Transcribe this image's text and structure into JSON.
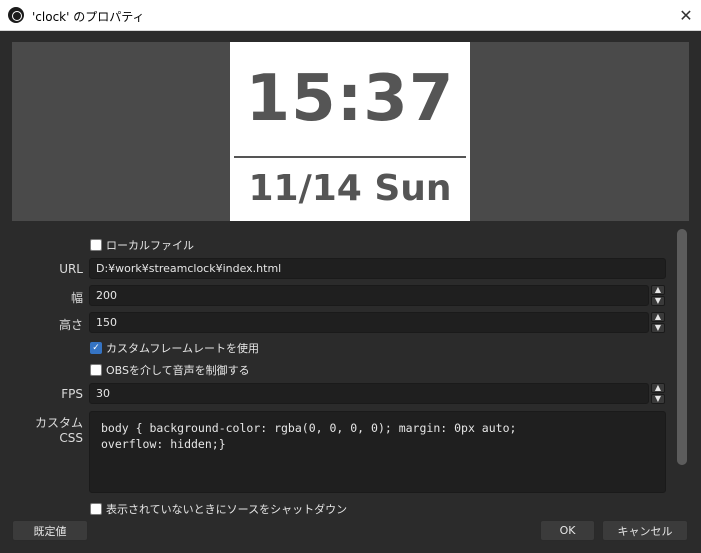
{
  "window": {
    "title": "'clock' のプロパティ"
  },
  "preview": {
    "time": "15:37",
    "date": "11/14 Sun"
  },
  "form": {
    "local_file_label": "ローカルファイル",
    "url": {
      "label": "URL",
      "value": "D:¥work¥streamclock¥index.html"
    },
    "width": {
      "label": "幅",
      "value": "200"
    },
    "height": {
      "label": "高さ",
      "value": "150"
    },
    "custom_fps_label": "カスタムフレームレートを使用",
    "obs_audio_label": "OBSを介して音声を制御する",
    "fps": {
      "label": "FPS",
      "value": "30"
    },
    "custom_css": {
      "label": "カスタム CSS",
      "value": "body { background-color: rgba(0, 0, 0, 0); margin: 0px auto;\noverflow: hidden;}"
    },
    "shutdown_label": "表示されていないときにソースをシャットダウン"
  },
  "buttons": {
    "defaults": "既定値",
    "ok": "OK",
    "cancel": "キャンセル"
  }
}
